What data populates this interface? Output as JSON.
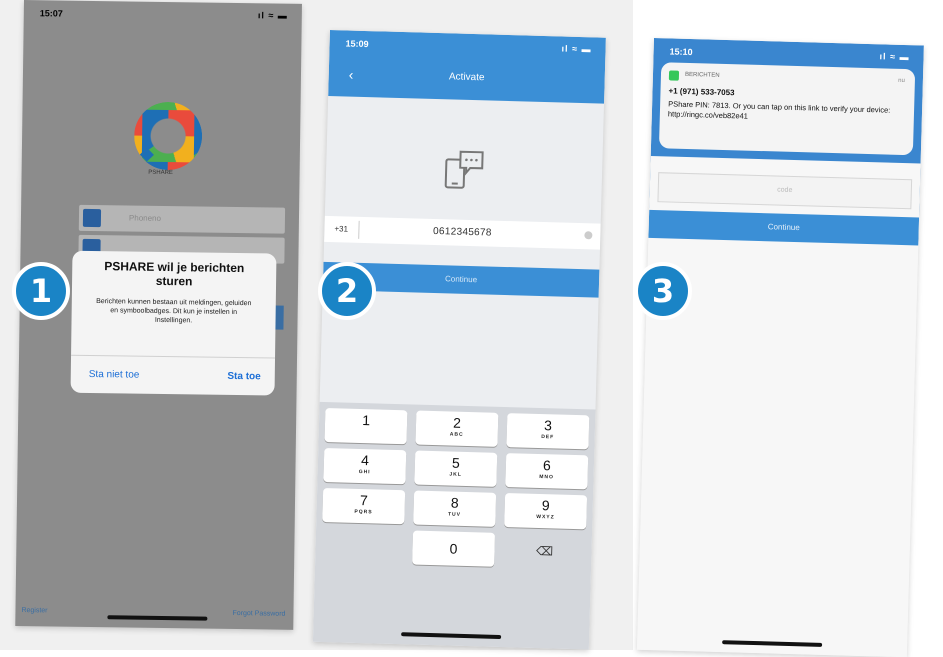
{
  "steps": [
    {
      "number": "1"
    },
    {
      "number": "2"
    },
    {
      "number": "3"
    }
  ],
  "phone1": {
    "status": {
      "time": "15:07",
      "signal": "ıl ≈ ▬"
    },
    "logo_caption": "PSHARE",
    "fields": [
      {
        "placeholder": "Phoneno"
      },
      {
        "placeholder": ""
      }
    ],
    "dialog": {
      "title": "PSHARE wil je berichten sturen",
      "message": "Berichten kunnen bestaan uit meldingen, geluiden en symboolbadges. Dit kun je instellen in Instellingen.",
      "deny": "Sta niet toe",
      "allow": "Sta toe"
    },
    "footer_left": "Register",
    "footer_right": "Forgot Password"
  },
  "phone2": {
    "status": {
      "time": "15:09",
      "signal": "ıl ≈ ▬"
    },
    "back": "‹",
    "title": "Activate",
    "country_code": "+31",
    "phone_number": "0612345678",
    "continue": "Continue",
    "keys": [
      {
        "n": "1",
        "l": ""
      },
      {
        "n": "2",
        "l": "ABC"
      },
      {
        "n": "3",
        "l": "DEF"
      },
      {
        "n": "4",
        "l": "GHI"
      },
      {
        "n": "5",
        "l": "JKL"
      },
      {
        "n": "6",
        "l": "MNO"
      },
      {
        "n": "7",
        "l": "PQRS"
      },
      {
        "n": "8",
        "l": "TUV"
      },
      {
        "n": "9",
        "l": "WXYZ"
      },
      {
        "n": "0",
        "l": ""
      }
    ],
    "delete": "⌫"
  },
  "phone3": {
    "status": {
      "time": "15:10",
      "signal": "ıl ≈ ▬"
    },
    "notification": {
      "app": "BERICHTEN",
      "when": "nu",
      "sender": "+1 (971) 533-7053",
      "body": "PShare PIN: 7813. Or you can tap on this link to verify your device: http://ringc.co/veb82e41"
    },
    "code_placeholder": "code",
    "continue": "Continue"
  },
  "colors": {
    "badge": "#1a84c6",
    "primary": "#3b8fd6"
  }
}
